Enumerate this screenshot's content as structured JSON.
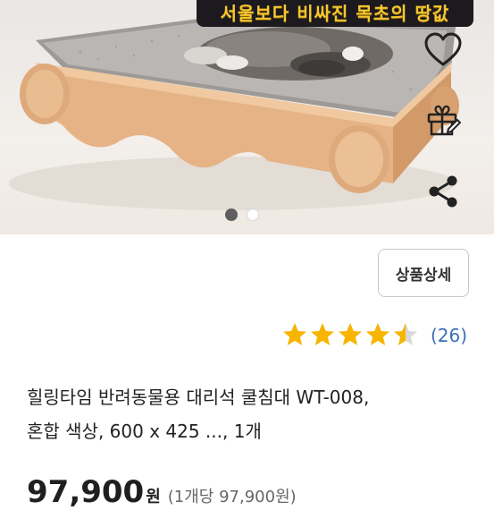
{
  "hero": {
    "banner_text": "서울보다 비싸진 목초의 땅값",
    "carousel": {
      "total": 2,
      "active_index": 0
    }
  },
  "actions": {
    "wishlist_icon": "heart-outline-icon",
    "gift_icon": "gift-icon",
    "share_icon": "share-icon"
  },
  "detail_button_label": "상품상세",
  "rating": {
    "stars": 4.5,
    "max": 5,
    "count_text": "(26)",
    "star_color": "#f7b500"
  },
  "product": {
    "title_line1": "힐링타임 반려동물용 대리석 쿨침대 WT-008,",
    "title_line2": "혼합 색상, 600 x 425 ..., 1개"
  },
  "price": {
    "value": "97,900",
    "currency": "원",
    "unit_price": "(1개당 97,900원)"
  }
}
